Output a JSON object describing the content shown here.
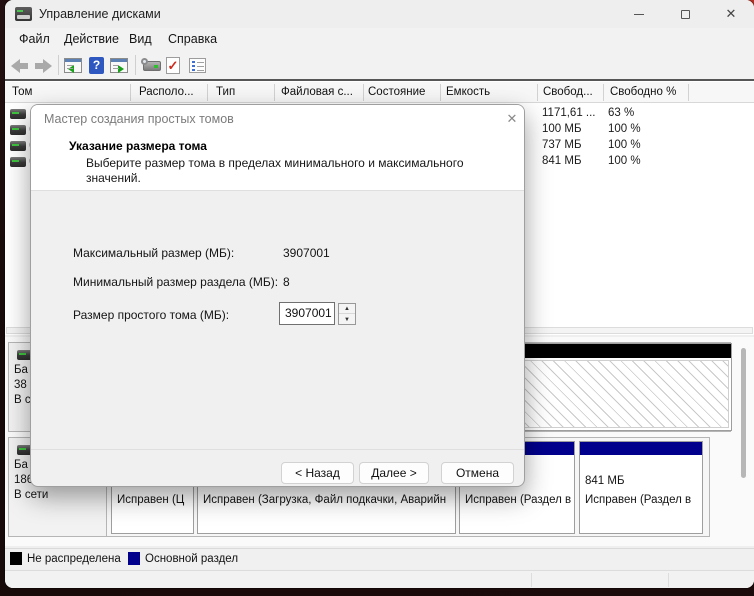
{
  "window": {
    "title": "Управление дисками",
    "controls": {
      "minimize": "–",
      "maximize": "",
      "close": "✕"
    }
  },
  "menu": {
    "items": [
      "Файл",
      "Действие",
      "Вид",
      "Справка"
    ]
  },
  "toolbar": {
    "icons": [
      "back-arrow",
      "forward-arrow",
      "console-tree-left",
      "help",
      "console-tree-right",
      "disk-properties",
      "action-check-document",
      "view-checklist"
    ],
    "help_glyph": "?",
    "check_glyph": "✓"
  },
  "volume_table": {
    "columns": [
      "Том",
      "Располо...",
      "Тип",
      "Файловая с...",
      "Состояние",
      "Емкость",
      "Свобод...",
      "Свободно %"
    ],
    "rows": [
      {
        "name": "",
        "free": "1171,61 ...",
        "free_pct": "63 %"
      },
      {
        "name": "(",
        "free": "100 МБ",
        "free_pct": "100 %"
      },
      {
        "name": "(",
        "free": "737 МБ",
        "free_pct": "100 %"
      },
      {
        "name": "(",
        "free": "841 МБ",
        "free_pct": "100 %"
      }
    ]
  },
  "wizard": {
    "title": "Мастер создания простых томов",
    "close_glyph": "✕",
    "heading": "Указание размера тома",
    "description": "Выберите размер тома в пределах минимального и максимального значений.",
    "fields": [
      {
        "label": "Максимальный размер (МБ):",
        "value": "3907001"
      },
      {
        "label": "Минимальный размер раздела (МБ):",
        "value": "8"
      },
      {
        "label": "Размер простого тома (МБ):",
        "value": "3907001"
      }
    ],
    "spinner": {
      "up": "▲",
      "down": "▼"
    },
    "buttons": {
      "back": "< Назад",
      "next": "Далее >",
      "cancel": "Отмена"
    }
  },
  "disks": [
    {
      "label_lines": [
        "Ба",
        "38",
        "В с"
      ],
      "unallocated": {
        "color": "#000000"
      }
    },
    {
      "label_lines": [
        "Ба",
        "186",
        "В сети"
      ],
      "partitions": [
        {
          "size": "",
          "status": "Исправен (Ц"
        },
        {
          "size": "",
          "status": "Исправен (Загрузка, Файл подкачки, Аварийн"
        },
        {
          "size": "",
          "status": "Исправен (Раздел в"
        },
        {
          "size": "841 МБ",
          "status": "Исправен (Раздел в"
        }
      ]
    }
  ],
  "legend": [
    {
      "label": "Не распределена",
      "color": "#000000"
    },
    {
      "label": "Основной раздел",
      "color": "#00008c"
    }
  ],
  "colors": {
    "primary_partition": "#00008c",
    "unallocated": "#000000"
  }
}
